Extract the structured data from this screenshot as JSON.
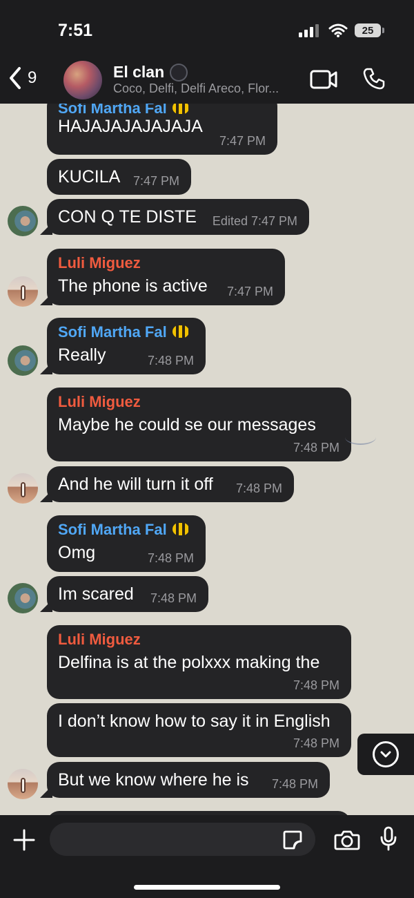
{
  "status_bar": {
    "time": "7:51",
    "battery": "25"
  },
  "header": {
    "back_count": "9",
    "title": "El clan",
    "members": "Coco, Delfi, Delfi Areco, Flor..."
  },
  "messages": [
    {
      "sender": "Sofi Martha Fal",
      "text": "HAJAJAJAJAJAJA",
      "time": "7:47 PM"
    },
    {
      "text": "KUCILA",
      "time": "7:47 PM"
    },
    {
      "text": "CON Q TE DISTE",
      "time": "Edited 7:47 PM"
    },
    {
      "sender": "Luli  Miguez",
      "text": "The phone is active",
      "time": "7:47 PM"
    },
    {
      "sender": "Sofi Martha Fal",
      "text": "Really",
      "time": "7:48 PM"
    },
    {
      "sender": "Luli  Miguez",
      "text": "Maybe he could se our messages",
      "time": "7:48 PM"
    },
    {
      "text": "And he will turn it off",
      "time": "7:48 PM"
    },
    {
      "sender": "Sofi Martha Fal",
      "text": "Omg",
      "time": "7:48 PM"
    },
    {
      "text": "Im scared",
      "time": "7:48 PM"
    },
    {
      "sender": "Luli  Miguez",
      "text": "Delfina is at the polxxx making the",
      "time": "7:48 PM"
    },
    {
      "text": "I don’t know how to say it in English",
      "time": "7:48 PM"
    },
    {
      "text": "But we know where he is",
      "time": "7:48 PM"
    }
  ],
  "composer": {
    "placeholder": ""
  },
  "colors": {
    "header_bg": "#1c1c1e",
    "chat_bg": "#dcd9cf",
    "bubble_bg": "#242426",
    "sender_blue": "#50a7f5",
    "sender_orange": "#f05b3f"
  }
}
